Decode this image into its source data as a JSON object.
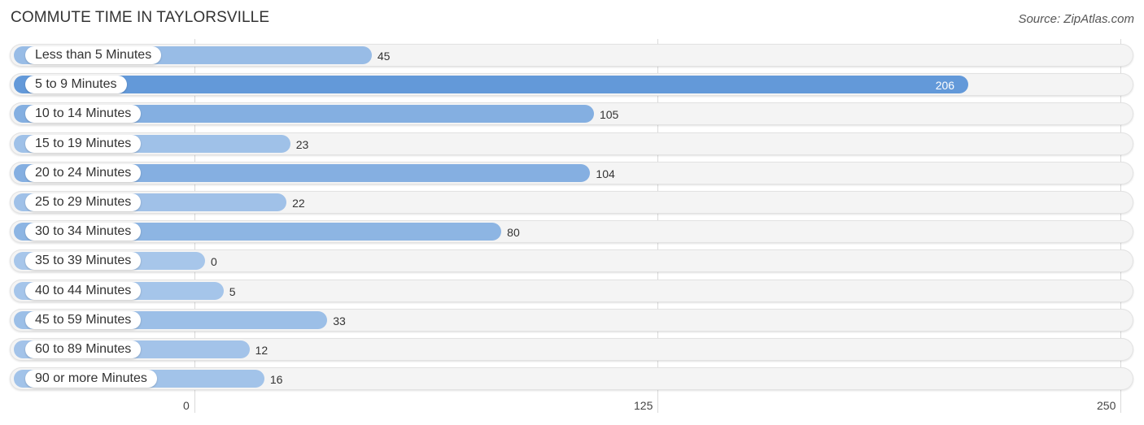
{
  "title": "COMMUTE TIME IN TAYLORSVILLE",
  "source": "Source: ZipAtlas.com",
  "colors": {
    "bar_max": "#6399d9",
    "bar_min": "#a7c6ea",
    "track": "#f4f4f4"
  },
  "chart_data": {
    "type": "bar",
    "orientation": "horizontal",
    "title": "COMMUTE TIME IN TAYLORSVILLE",
    "xlabel": "",
    "ylabel": "",
    "xlim": [
      0,
      250
    ],
    "xticks": [
      "0",
      "125",
      "250"
    ],
    "grid": true,
    "categories": [
      "Less than 5 Minutes",
      "5 to 9 Minutes",
      "10 to 14 Minutes",
      "15 to 19 Minutes",
      "20 to 24 Minutes",
      "25 to 29 Minutes",
      "30 to 34 Minutes",
      "35 to 39 Minutes",
      "40 to 44 Minutes",
      "45 to 59 Minutes",
      "60 to 89 Minutes",
      "90 or more Minutes"
    ],
    "values": [
      45,
      206,
      105,
      23,
      104,
      22,
      80,
      0,
      5,
      33,
      12,
      16
    ]
  }
}
